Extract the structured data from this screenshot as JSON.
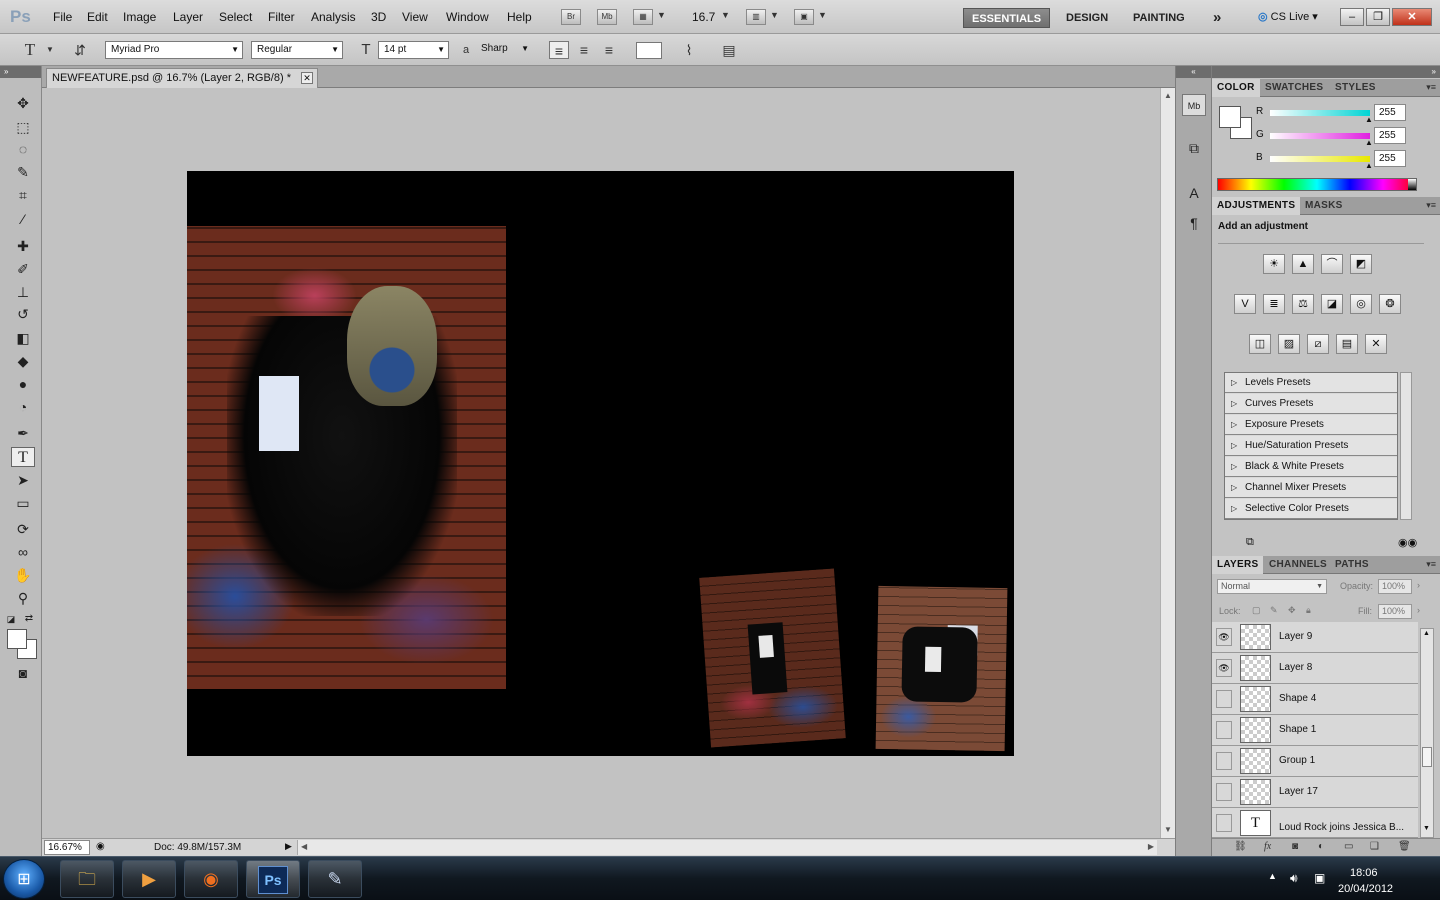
{
  "app": {
    "logo": "Ps"
  },
  "menu": [
    "File",
    "Edit",
    "Image",
    "Layer",
    "Select",
    "Filter",
    "Analysis",
    "3D",
    "View",
    "Window",
    "Help"
  ],
  "menubar_icons": {
    "bridge": "Br",
    "minibridge": "Mb"
  },
  "zoom_display": "16.7",
  "workspaces": {
    "essentials": "ESSENTIALS",
    "design": "DESIGN",
    "painting": "PAINTING",
    "more": "»"
  },
  "cs_live": "CS Live",
  "window_controls": {
    "minimize": "–",
    "restore": "❐",
    "close": "✕"
  },
  "options": {
    "font_family": "Myriad Pro",
    "font_style": "Regular",
    "font_size": "14 pt",
    "aa_label": "a",
    "antialias": "Sharp"
  },
  "document": {
    "tab_title": "NEWFEATURE.psd @ 16.7% (Layer 2, RGB/8) *",
    "close": "✕",
    "canvas_color": "#000000"
  },
  "status": {
    "zoom": "16.67%",
    "doc_size": "Doc: 49.8M/157.3M"
  },
  "color_panel": {
    "tabs": [
      "COLOR",
      "SWATCHES",
      "STYLES"
    ],
    "channels": [
      {
        "label": "R",
        "value": "255",
        "gradient": "#00d4d4"
      },
      {
        "label": "G",
        "value": "255",
        "gradient": "#e020e0"
      },
      {
        "label": "B",
        "value": "255",
        "gradient": "#e8e800"
      }
    ]
  },
  "adjustments_panel": {
    "tabs": [
      "ADJUSTMENTS",
      "MASKS"
    ],
    "heading": "Add an adjustment",
    "presets": [
      "Levels Presets",
      "Curves Presets",
      "Exposure Presets",
      "Hue/Saturation Presets",
      "Black & White Presets",
      "Channel Mixer Presets",
      "Selective Color Presets"
    ]
  },
  "layers_panel": {
    "tabs": [
      "LAYERS",
      "CHANNELS",
      "PATHS"
    ],
    "blend_mode": "Normal",
    "opacity_label": "Opacity:",
    "opacity": "100%",
    "lock_label": "Lock:",
    "fill_label": "Fill:",
    "fill": "100%",
    "layers": [
      {
        "name": "Layer 9",
        "visible": true,
        "thumb": ""
      },
      {
        "name": "Layer 8",
        "visible": true,
        "thumb": ""
      },
      {
        "name": "Shape 4",
        "visible": false,
        "thumb": ""
      },
      {
        "name": "Shape 1",
        "visible": false,
        "thumb": ""
      },
      {
        "name": "Group 1",
        "visible": false,
        "thumb": ""
      },
      {
        "name": "Layer 17",
        "visible": false,
        "thumb": ""
      },
      {
        "name": "Loud Rock joins Jessica B...",
        "visible": false,
        "thumb": "T"
      }
    ],
    "footer_fx": "fx"
  },
  "taskbar": {
    "clock_time": "18:06",
    "clock_date": "20/04/2012",
    "ps_label": "Ps"
  }
}
